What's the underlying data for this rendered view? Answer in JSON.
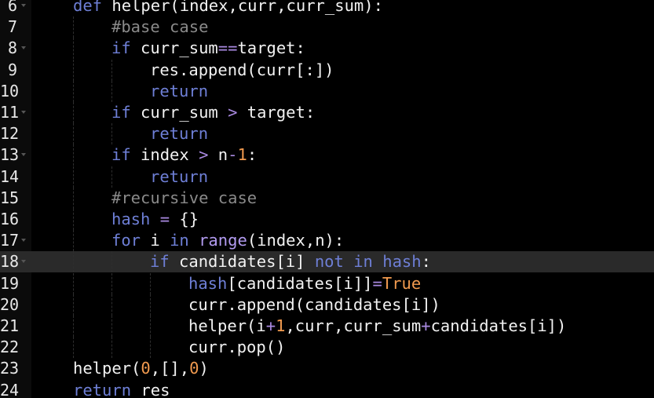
{
  "editor": {
    "current_line": 18,
    "lines": [
      {
        "n": "6",
        "fold": true,
        "indent": 0,
        "tokens": [
          [
            "kw",
            "def"
          ],
          [
            "",
            " helper(index,curr,curr_sum):"
          ]
        ]
      },
      {
        "n": "7",
        "fold": false,
        "indent": 1,
        "tokens": [
          [
            "cm",
            "#base case"
          ]
        ]
      },
      {
        "n": "8",
        "fold": true,
        "indent": 1,
        "tokens": [
          [
            "kw",
            "if"
          ],
          [
            "",
            " curr_sum"
          ],
          [
            "op",
            "=="
          ],
          [
            "",
            "target:"
          ]
        ]
      },
      {
        "n": "9",
        "fold": false,
        "indent": 2,
        "tokens": [
          [
            "",
            "res.append(curr[:])"
          ]
        ]
      },
      {
        "n": "10",
        "fold": false,
        "indent": 2,
        "tokens": [
          [
            "kw",
            "return"
          ]
        ]
      },
      {
        "n": "11",
        "fold": true,
        "indent": 1,
        "tokens": [
          [
            "kw",
            "if"
          ],
          [
            "",
            " curr_sum "
          ],
          [
            "op",
            ">"
          ],
          [
            "",
            " target:"
          ]
        ]
      },
      {
        "n": "12",
        "fold": false,
        "indent": 2,
        "tokens": [
          [
            "kw",
            "return"
          ]
        ]
      },
      {
        "n": "13",
        "fold": true,
        "indent": 1,
        "tokens": [
          [
            "kw",
            "if"
          ],
          [
            "",
            " index "
          ],
          [
            "op",
            ">"
          ],
          [
            "",
            " n"
          ],
          [
            "op",
            "-"
          ],
          [
            "num",
            "1"
          ],
          [
            "",
            ":"
          ]
        ]
      },
      {
        "n": "14",
        "fold": false,
        "indent": 2,
        "tokens": [
          [
            "kw",
            "return"
          ]
        ]
      },
      {
        "n": "15",
        "fold": false,
        "indent": 1,
        "tokens": [
          [
            "cm",
            "#recursive case"
          ]
        ]
      },
      {
        "n": "16",
        "fold": false,
        "indent": 1,
        "tokens": [
          [
            "kw",
            "hash"
          ],
          [
            "",
            " "
          ],
          [
            "op",
            "="
          ],
          [
            "",
            " {}"
          ]
        ]
      },
      {
        "n": "17",
        "fold": true,
        "indent": 1,
        "tokens": [
          [
            "kw",
            "for"
          ],
          [
            "",
            " i "
          ],
          [
            "kw",
            "in"
          ],
          [
            "",
            " "
          ],
          [
            "bi",
            "range"
          ],
          [
            "",
            "(index,n):"
          ]
        ]
      },
      {
        "n": "18",
        "fold": true,
        "indent": 2,
        "tokens": [
          [
            "kw",
            "if"
          ],
          [
            "",
            " candidates[i] "
          ],
          [
            "kw",
            "not"
          ],
          [
            "",
            " "
          ],
          [
            "kw",
            "in"
          ],
          [
            "",
            " "
          ],
          [
            "kw",
            "hash"
          ],
          [
            "",
            ":"
          ]
        ]
      },
      {
        "n": "19",
        "fold": false,
        "indent": 3,
        "tokens": [
          [
            "kw",
            "hash"
          ],
          [
            "",
            "[candidates[i]]"
          ],
          [
            "op",
            "="
          ],
          [
            "num",
            "True"
          ]
        ]
      },
      {
        "n": "20",
        "fold": false,
        "indent": 3,
        "tokens": [
          [
            "",
            "curr.append(candidates[i])"
          ]
        ]
      },
      {
        "n": "21",
        "fold": false,
        "indent": 3,
        "tokens": [
          [
            "",
            "helper(i"
          ],
          [
            "op",
            "+"
          ],
          [
            "num",
            "1"
          ],
          [
            "",
            ",curr,curr_sum"
          ],
          [
            "op",
            "+"
          ],
          [
            "",
            "candidates[i])"
          ]
        ]
      },
      {
        "n": "22",
        "fold": false,
        "indent": 3,
        "tokens": [
          [
            "",
            "curr.pop()"
          ]
        ]
      },
      {
        "n": "23",
        "fold": false,
        "indent": 0,
        "tokens": [
          [
            "",
            "helper("
          ],
          [
            "num",
            "0"
          ],
          [
            "",
            ",[],"
          ],
          [
            "num",
            "0"
          ],
          [
            "",
            ")"
          ]
        ]
      },
      {
        "n": "24",
        "fold": false,
        "indent": 0,
        "tokens": [
          [
            "kw",
            "return"
          ],
          [
            "",
            " res"
          ]
        ]
      }
    ]
  }
}
